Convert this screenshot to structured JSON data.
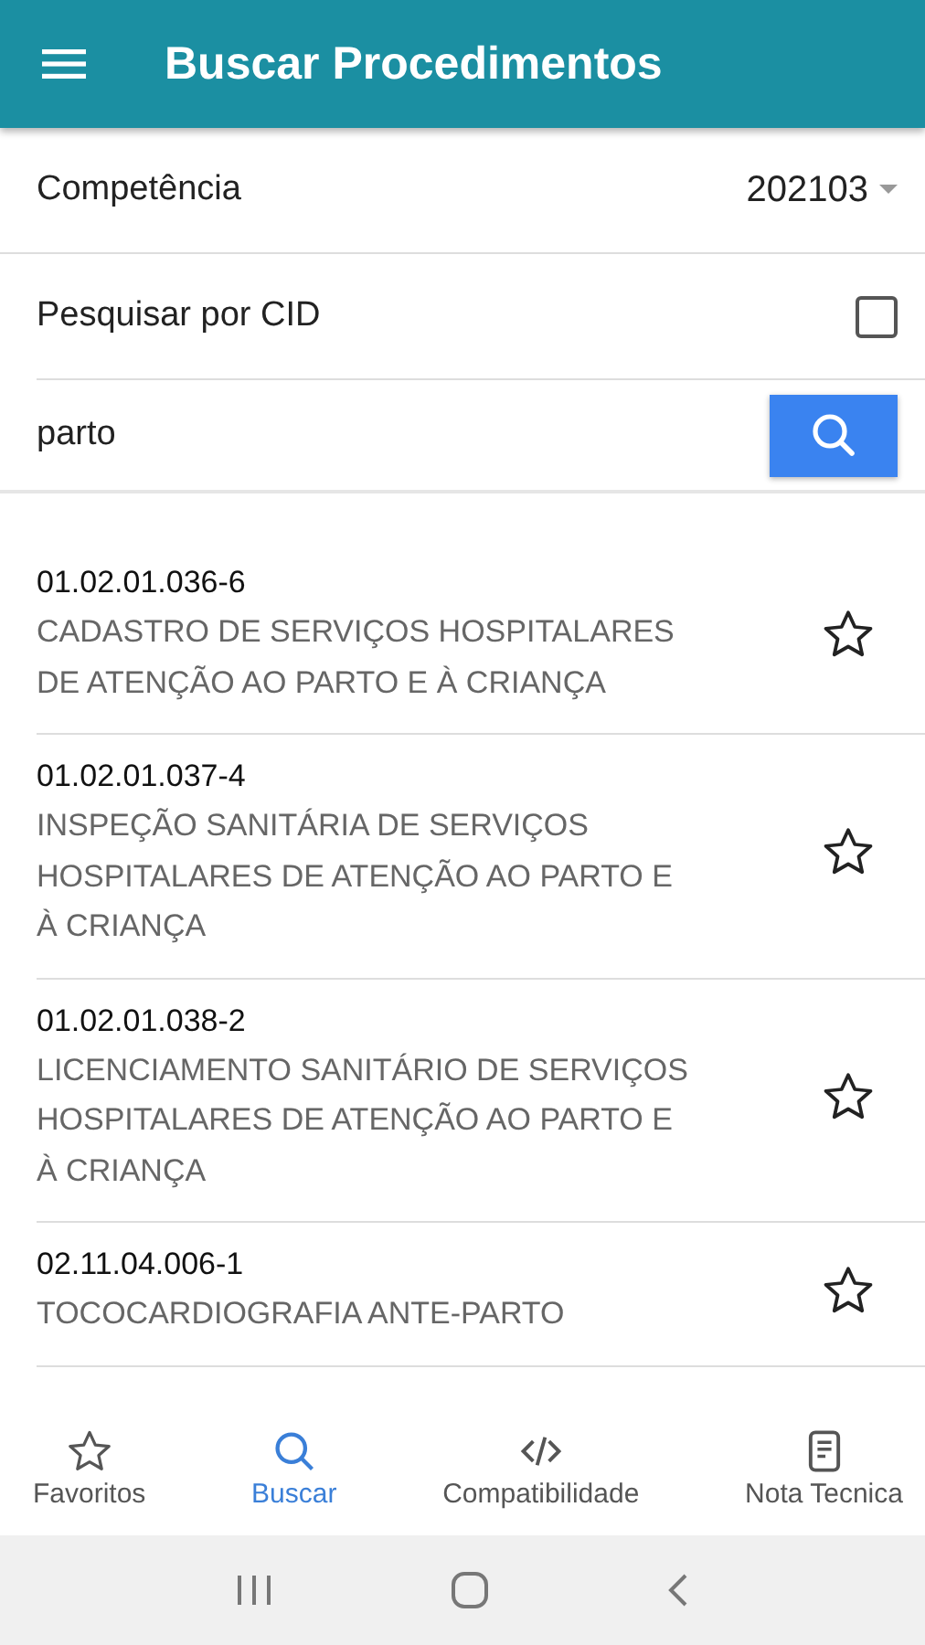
{
  "app_bar": {
    "title": "Buscar Procedimentos"
  },
  "competencia": {
    "label": "Competência",
    "value": "202103"
  },
  "cid_option": {
    "label": "Pesquisar por CID",
    "checked": false
  },
  "search": {
    "value": "parto"
  },
  "results": [
    {
      "code": "01.02.01.036-6",
      "description": "CADASTRO DE SERVIÇOS HOSPITALARES DE ATENÇÃO AO PARTO E À CRIANÇA",
      "favorite": false
    },
    {
      "code": "01.02.01.037-4",
      "description": "INSPEÇÃO SANITÁRIA DE SERVIÇOS HOSPITALARES DE ATENÇÃO AO PARTO E À CRIANÇA",
      "favorite": false
    },
    {
      "code": "01.02.01.038-2",
      "description": "LICENCIAMENTO SANITÁRIO DE SERVIÇOS HOSPITALARES DE ATENÇÃO AO PARTO E À CRIANÇA",
      "favorite": false
    },
    {
      "code": "02.11.04.006-1",
      "description": "TOCOCARDIOGRAFIA ANTE-PARTO",
      "favorite": false
    }
  ],
  "bottom_nav": [
    {
      "label": "Favoritos",
      "kind": "star",
      "selected": false
    },
    {
      "label": "Buscar",
      "kind": "search",
      "selected": true
    },
    {
      "label": "Compatibilidade",
      "kind": "code",
      "selected": false
    },
    {
      "label": "Nota Tecnica",
      "kind": "note",
      "selected": false
    }
  ]
}
